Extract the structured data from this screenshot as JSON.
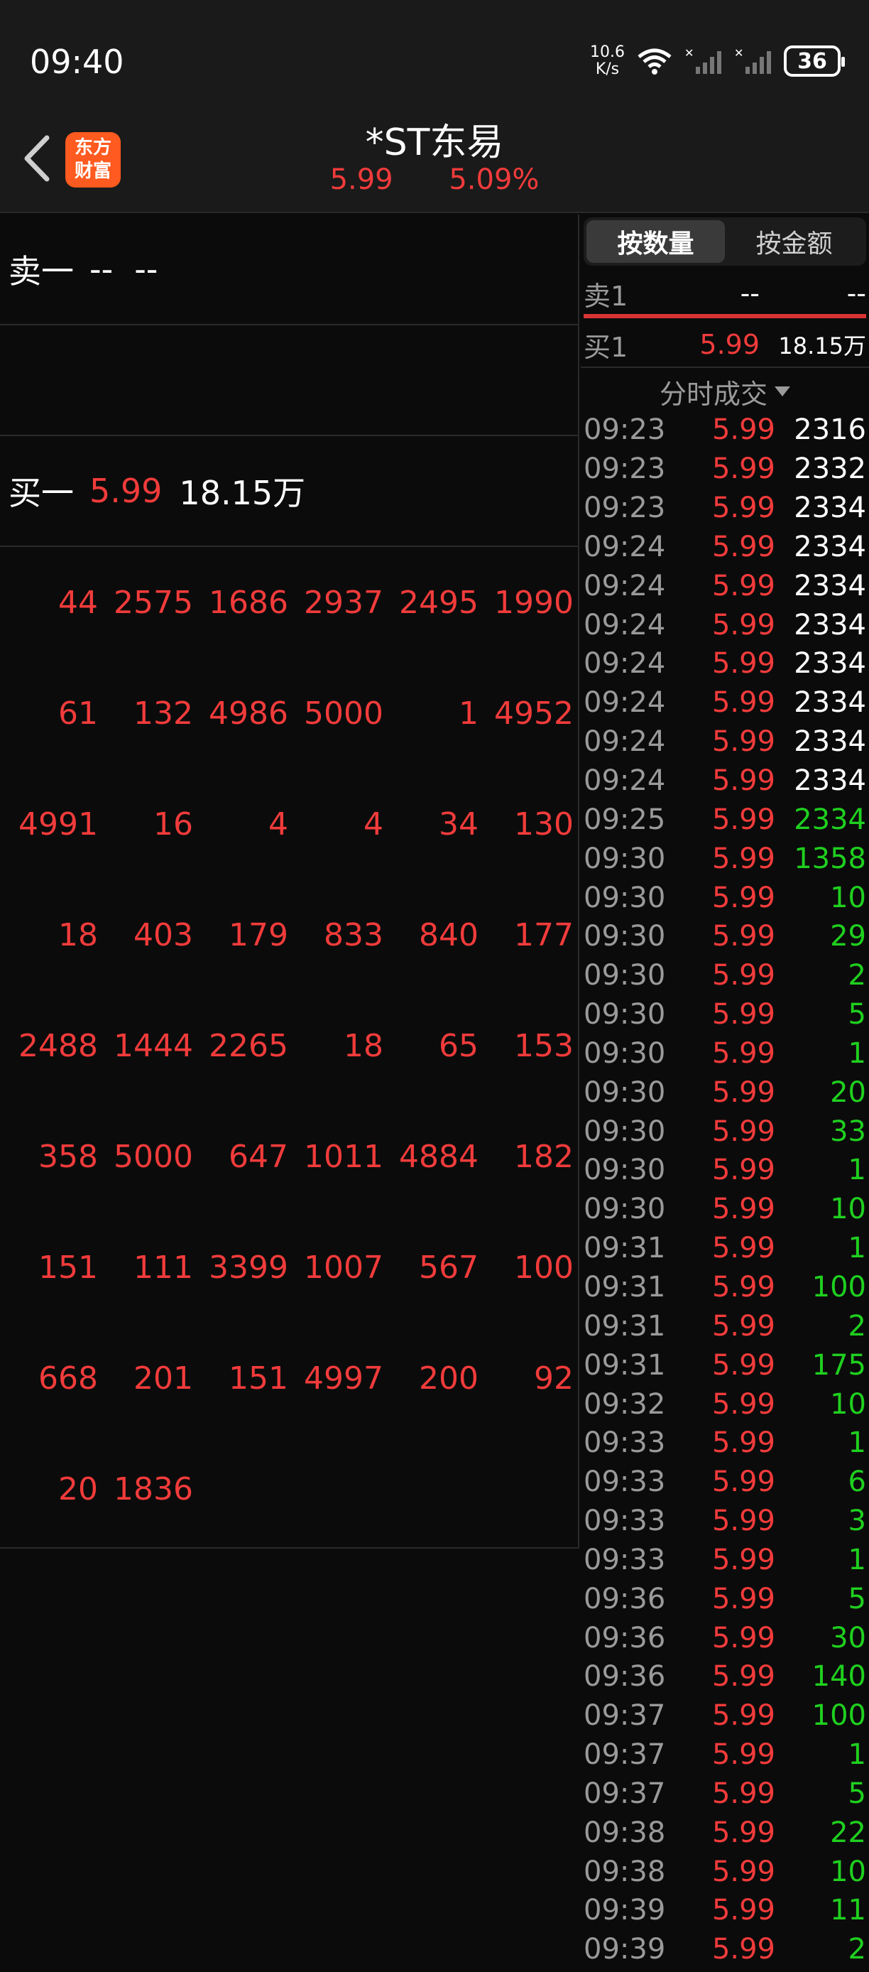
{
  "status_bar": {
    "time": "09:40",
    "net_speed_value": "10.6",
    "net_speed_unit": "K/s",
    "battery": "36",
    "wifi_icon": "wifi-icon",
    "signal_icon": "signal-icon"
  },
  "header": {
    "title": "*ST东易",
    "price": "5.99",
    "change_pct": "5.09%",
    "logo_line1": "东方",
    "logo_line2": "财富"
  },
  "colors": {
    "up": "#f23b3b",
    "down": "#1fd01f",
    "bg": "#0b0b0b",
    "panel": "#1a1a1a"
  },
  "order_book": {
    "sell1": {
      "label": "卖一",
      "price": "--",
      "volume": "--"
    },
    "buy1": {
      "label": "买一",
      "price": "5.99",
      "volume": "18.15万"
    }
  },
  "queue": [
    [
      "44",
      "2575",
      "1686",
      "2937",
      "2495",
      "1990"
    ],
    [
      "61",
      "132",
      "4986",
      "5000",
      "1",
      "4952"
    ],
    [
      "4991",
      "16",
      "4",
      "4",
      "34",
      "130"
    ],
    [
      "18",
      "403",
      "179",
      "833",
      "840",
      "177"
    ],
    [
      "2488",
      "1444",
      "2265",
      "18",
      "65",
      "153"
    ],
    [
      "358",
      "5000",
      "647",
      "1011",
      "4884",
      "182"
    ],
    [
      "151",
      "111",
      "3399",
      "1007",
      "567",
      "100"
    ],
    [
      "668",
      "201",
      "151",
      "4997",
      "200",
      "92"
    ],
    [
      "20",
      "1836",
      "",
      "",
      "",
      ""
    ]
  ],
  "right_panel": {
    "tabs": [
      {
        "label": "按数量",
        "active": true
      },
      {
        "label": "按金额",
        "active": false
      }
    ],
    "sell1": {
      "label": "卖1",
      "price": "--",
      "volume": "--"
    },
    "buy1": {
      "label": "买1",
      "price": "5.99",
      "volume": "18.15万"
    },
    "ticks_header": "分时成交",
    "ticks": [
      [
        "09:23",
        "5.99",
        "2316",
        "white"
      ],
      [
        "09:23",
        "5.99",
        "2332",
        "white"
      ],
      [
        "09:23",
        "5.99",
        "2334",
        "white"
      ],
      [
        "09:24",
        "5.99",
        "2334",
        "white"
      ],
      [
        "09:24",
        "5.99",
        "2334",
        "white"
      ],
      [
        "09:24",
        "5.99",
        "2334",
        "white"
      ],
      [
        "09:24",
        "5.99",
        "2334",
        "white"
      ],
      [
        "09:24",
        "5.99",
        "2334",
        "white"
      ],
      [
        "09:24",
        "5.99",
        "2334",
        "white"
      ],
      [
        "09:24",
        "5.99",
        "2334",
        "white"
      ],
      [
        "09:25",
        "5.99",
        "2334",
        "green"
      ],
      [
        "09:30",
        "5.99",
        "1358",
        "green"
      ],
      [
        "09:30",
        "5.99",
        "10",
        "green"
      ],
      [
        "09:30",
        "5.99",
        "29",
        "green"
      ],
      [
        "09:30",
        "5.99",
        "2",
        "green"
      ],
      [
        "09:30",
        "5.99",
        "5",
        "green"
      ],
      [
        "09:30",
        "5.99",
        "1",
        "green"
      ],
      [
        "09:30",
        "5.99",
        "20",
        "green"
      ],
      [
        "09:30",
        "5.99",
        "33",
        "green"
      ],
      [
        "09:30",
        "5.99",
        "1",
        "green"
      ],
      [
        "09:30",
        "5.99",
        "10",
        "green"
      ],
      [
        "09:31",
        "5.99",
        "1",
        "green"
      ],
      [
        "09:31",
        "5.99",
        "100",
        "green"
      ],
      [
        "09:31",
        "5.99",
        "2",
        "green"
      ],
      [
        "09:31",
        "5.99",
        "175",
        "green"
      ],
      [
        "09:32",
        "5.99",
        "10",
        "green"
      ],
      [
        "09:33",
        "5.99",
        "1",
        "green"
      ],
      [
        "09:33",
        "5.99",
        "6",
        "green"
      ],
      [
        "09:33",
        "5.99",
        "3",
        "green"
      ],
      [
        "09:33",
        "5.99",
        "1",
        "green"
      ],
      [
        "09:36",
        "5.99",
        "5",
        "green"
      ],
      [
        "09:36",
        "5.99",
        "30",
        "green"
      ],
      [
        "09:36",
        "5.99",
        "140",
        "green"
      ],
      [
        "09:37",
        "5.99",
        "100",
        "green"
      ],
      [
        "09:37",
        "5.99",
        "1",
        "green"
      ],
      [
        "09:37",
        "5.99",
        "5",
        "green"
      ],
      [
        "09:38",
        "5.99",
        "22",
        "green"
      ],
      [
        "09:38",
        "5.99",
        "10",
        "green"
      ],
      [
        "09:39",
        "5.99",
        "11",
        "green"
      ],
      [
        "09:39",
        "5.99",
        "2",
        "green"
      ]
    ]
  }
}
